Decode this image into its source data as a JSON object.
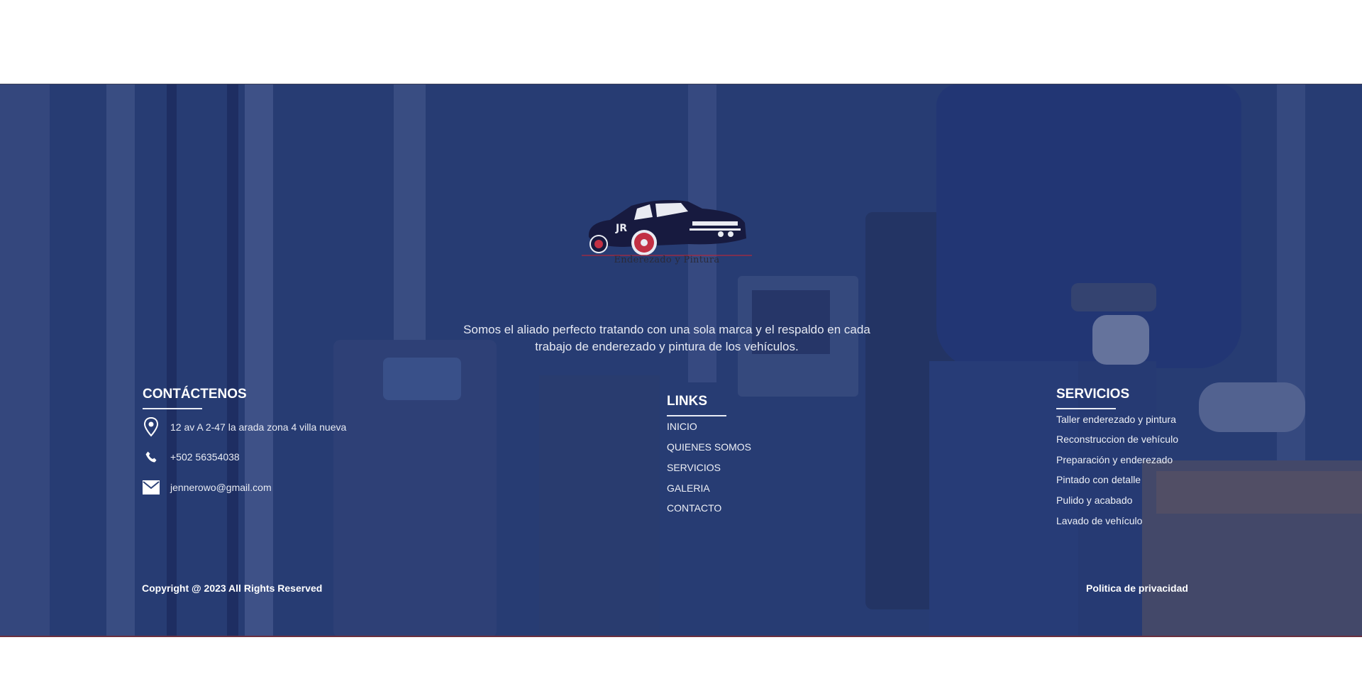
{
  "brand": {
    "logo_initials": "JR",
    "logo_caption": "Enderezado y Pintura"
  },
  "tagline": "Somos el aliado perfecto tratando con una sola marca y el respaldo en cada trabajo de enderezado y pintura de los vehículos.",
  "contact": {
    "title": "CONTÁCTENOS",
    "address": "12 av A 2-47 la arada zona 4 villa nueva",
    "phone": "+502 56354038",
    "email": "jennerowo@gmail.com"
  },
  "links": {
    "title": "LINKS",
    "items": [
      "INICIO",
      "QUIENES SOMOS",
      "SERVICIOS",
      "GALERIA",
      "CONTACTO"
    ]
  },
  "services": {
    "title": "SERVICIOS",
    "items": [
      "Taller enderezado y pintura",
      "Reconstruccion de vehículo",
      "Preparación y enderezado",
      "Pintado con detalle",
      "Pulido y acabado",
      "Lavado de vehículo"
    ]
  },
  "footer": {
    "copyright": "Copyright @ 2023 All Rights Reserved",
    "privacy": "Politica de privacidad"
  },
  "colors": {
    "overlay": "#2d4378",
    "logo_car": "#171a3f",
    "logo_wheel": "#c23044"
  },
  "icons": [
    "location-pin-icon",
    "phone-icon",
    "mail-icon"
  ]
}
